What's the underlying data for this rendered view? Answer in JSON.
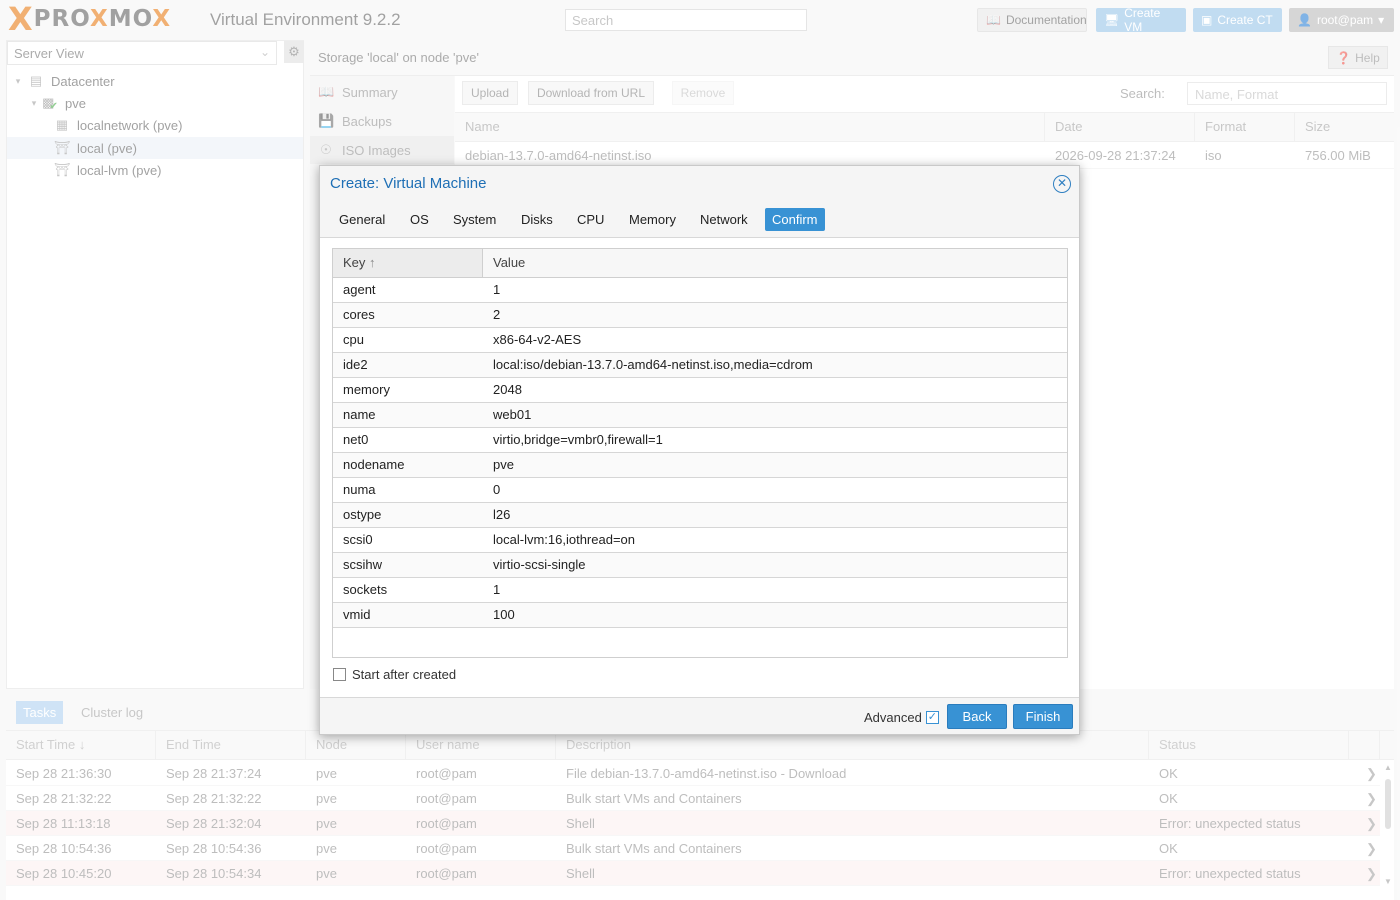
{
  "header": {
    "logo_x": "X",
    "logo_text_a": "PRO",
    "logo_text_b": "X",
    "logo_text_c": "M",
    "logo_text_d": "O",
    "logo_text_e": "X",
    "version": "Virtual Environment 9.2.2",
    "search_placeholder": "Search",
    "documentation": "Documentation",
    "create_vm": "Create VM",
    "create_ct": "Create CT",
    "user": "root@pam"
  },
  "left": {
    "view": "Server View",
    "tree": [
      {
        "label": "Datacenter"
      },
      {
        "label": "pve"
      },
      {
        "label": "localnetwork (pve)"
      },
      {
        "label": "local (pve)"
      },
      {
        "label": "local-lvm (pve)"
      }
    ]
  },
  "content": {
    "title": "Storage 'local' on node 'pve'",
    "help": "Help",
    "subnav": [
      {
        "label": "Summary"
      },
      {
        "label": "Backups"
      },
      {
        "label": "ISO Images"
      }
    ],
    "toolbar": {
      "upload": "Upload",
      "download": "Download from URL",
      "remove": "Remove",
      "search_label": "Search:",
      "search_placeholder": "Name, Format"
    },
    "columns": [
      "Name",
      "Date",
      "Format",
      "Size"
    ],
    "rows": [
      {
        "name": "debian-13.7.0-amd64-netinst.iso",
        "date": "2026-09-28 21:37:24",
        "format": "iso",
        "size": "756.00 MiB"
      }
    ]
  },
  "bottom": {
    "tabs": [
      "Tasks",
      "Cluster log"
    ],
    "columns": [
      "Start Time",
      "End Time",
      "Node",
      "User name",
      "Description",
      "Status"
    ],
    "rows": [
      {
        "start": "Sep 28 21:36:30",
        "end": "Sep 28 21:37:24",
        "node": "pve",
        "user": "root@pam",
        "desc": "File debian-13.7.0-amd64-netinst.iso - Download",
        "status": "OK"
      },
      {
        "start": "Sep 28 21:32:22",
        "end": "Sep 28 21:32:22",
        "node": "pve",
        "user": "root@pam",
        "desc": "Bulk start VMs and Containers",
        "status": "OK"
      },
      {
        "start": "Sep 28 11:13:18",
        "end": "Sep 28 21:32:04",
        "node": "pve",
        "user": "root@pam",
        "desc": "Shell",
        "status": "Error: unexpected status"
      },
      {
        "start": "Sep 28 10:54:36",
        "end": "Sep 28 10:54:36",
        "node": "pve",
        "user": "root@pam",
        "desc": "Bulk start VMs and Containers",
        "status": "OK"
      },
      {
        "start": "Sep 28 10:45:20",
        "end": "Sep 28 10:54:34",
        "node": "pve",
        "user": "root@pam",
        "desc": "Shell",
        "status": "Error: unexpected status"
      }
    ]
  },
  "modal": {
    "title": "Create: Virtual Machine",
    "tabs": [
      "General",
      "OS",
      "System",
      "Disks",
      "CPU",
      "Memory",
      "Network",
      "Confirm"
    ],
    "key_header": "Key",
    "value_header": "Value",
    "rows": [
      {
        "key": "agent",
        "value": "1"
      },
      {
        "key": "cores",
        "value": "2"
      },
      {
        "key": "cpu",
        "value": "x86-64-v2-AES"
      },
      {
        "key": "ide2",
        "value": "local:iso/debian-13.7.0-amd64-netinst.iso,media=cdrom"
      },
      {
        "key": "memory",
        "value": "2048"
      },
      {
        "key": "name",
        "value": "web01"
      },
      {
        "key": "net0",
        "value": "virtio,bridge=vmbr0,firewall=1"
      },
      {
        "key": "nodename",
        "value": "pve"
      },
      {
        "key": "numa",
        "value": "0"
      },
      {
        "key": "ostype",
        "value": "l26"
      },
      {
        "key": "scsi0",
        "value": "local-lvm:16,iothread=on"
      },
      {
        "key": "scsihw",
        "value": "virtio-scsi-single"
      },
      {
        "key": "sockets",
        "value": "1"
      },
      {
        "key": "vmid",
        "value": "100"
      }
    ],
    "start_after_created": "Start after created",
    "advanced": "Advanced",
    "back": "Back",
    "finish": "Finish"
  }
}
